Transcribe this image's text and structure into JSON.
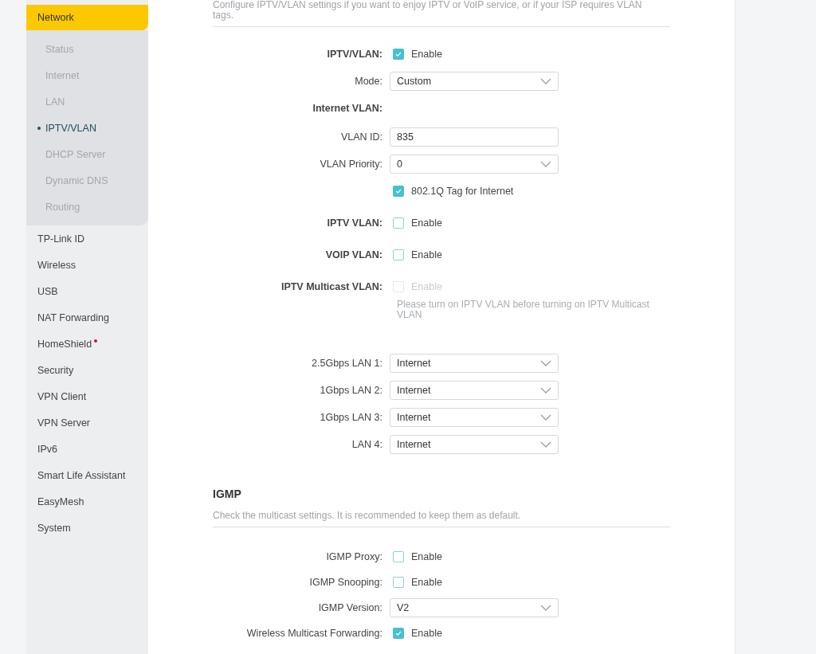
{
  "sidebar": {
    "active_group": {
      "label": "Network",
      "selected": true,
      "children": [
        {
          "label": "Status",
          "selected": false
        },
        {
          "label": "Internet",
          "selected": false
        },
        {
          "label": "LAN",
          "selected": false
        },
        {
          "label": "IPTV/VLAN",
          "selected": true
        },
        {
          "label": "DHCP Server",
          "selected": false
        },
        {
          "label": "Dynamic DNS",
          "selected": false
        },
        {
          "label": "Routing",
          "selected": false
        }
      ]
    },
    "items": [
      {
        "label": "TP-Link ID",
        "notification": false
      },
      {
        "label": "Wireless",
        "notification": false
      },
      {
        "label": "USB",
        "notification": false
      },
      {
        "label": "NAT Forwarding",
        "notification": false
      },
      {
        "label": "HomeShield",
        "notification": true
      },
      {
        "label": "Security",
        "notification": false
      },
      {
        "label": "VPN Client",
        "notification": false
      },
      {
        "label": "VPN Server",
        "notification": false
      },
      {
        "label": "IPv6",
        "notification": false
      },
      {
        "label": "Smart Life Assistant",
        "notification": false
      },
      {
        "label": "EasyMesh",
        "notification": false
      },
      {
        "label": "System",
        "notification": false
      }
    ]
  },
  "iptv_section": {
    "description": "Configure IPTV/VLAN settings if you want to enjoy IPTV or VoIP service, or if your ISP requires VLAN tags.",
    "rows": [
      {
        "kind": "checkbox",
        "label": "IPTV/VLAN:",
        "bold": true,
        "text": "Enable",
        "checked": true,
        "disabled": false
      },
      {
        "kind": "select",
        "label": "Mode:",
        "bold": false,
        "value": "Custom"
      },
      {
        "kind": "heading",
        "label": "Internet VLAN:",
        "bold": true
      },
      {
        "kind": "input",
        "label": "VLAN ID:",
        "bold": false,
        "value": "835"
      },
      {
        "kind": "select",
        "label": "VLAN Priority:",
        "bold": false,
        "value": "0"
      },
      {
        "kind": "checkbox",
        "text": "802.1Q Tag for Internet",
        "checked": true,
        "disabled": false
      },
      {
        "kind": "checkbox",
        "label": "IPTV VLAN:",
        "bold": true,
        "text": "Enable",
        "checked": false,
        "disabled": false
      },
      {
        "kind": "checkbox",
        "label": "VOIP VLAN:",
        "bold": true,
        "text": "Enable",
        "checked": false,
        "disabled": false
      },
      {
        "kind": "checkbox",
        "label": "IPTV Multicast VLAN:",
        "bold": true,
        "text": "Enable",
        "checked": false,
        "disabled": true,
        "note": "Please turn on IPTV VLAN before turning on IPTV Multicast VLAN"
      }
    ],
    "ports": [
      {
        "label": "2.5Gbps LAN 1:",
        "value": "Internet"
      },
      {
        "label": "1Gbps LAN 2:",
        "value": "Internet"
      },
      {
        "label": "1Gbps LAN 3:",
        "value": "Internet"
      },
      {
        "label": "LAN 4:",
        "value": "Internet"
      }
    ]
  },
  "igmp_section": {
    "title": "IGMP",
    "description": "Check the multicast settings. It is recommended to keep them as default.",
    "rows": [
      {
        "kind": "checkbox",
        "label": "IGMP Proxy:",
        "text": "Enable",
        "checked": false
      },
      {
        "kind": "checkbox",
        "label": "IGMP Snooping:",
        "text": "Enable",
        "checked": false
      },
      {
        "kind": "select",
        "label": "IGMP Version:",
        "value": "V2"
      },
      {
        "kind": "checkbox",
        "label": "Wireless Multicast Forwarding:",
        "text": "Enable",
        "checked": true
      }
    ]
  }
}
